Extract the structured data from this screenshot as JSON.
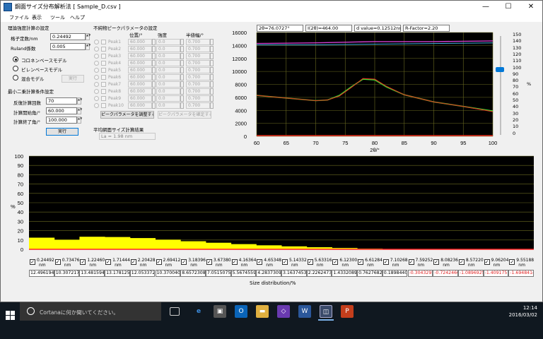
{
  "window": {
    "title": "鋼面サイズ分布解析法 [ Sample_D.csv ]",
    "minimize": "—",
    "maximize": "☐",
    "close": "✕"
  },
  "menu": [
    "ファイル",
    "表示",
    "ツール",
    "ヘルプ"
  ],
  "theory": {
    "section_title": "理論強度計算の設定",
    "lattice_label": "格子定数/nm",
    "lattice_value": "0.24492",
    "ruland_label": "Ruland係数",
    "ruland_value": "0.005",
    "models": [
      {
        "label": "コロネンベースモデル",
        "selected": true
      },
      {
        "label": "ピレンベースモデル",
        "selected": false
      },
      {
        "label": "混合モデル",
        "selected": false
      }
    ],
    "run_disabled": "実行"
  },
  "lsq": {
    "section_title": "最小二乗計算条件設定",
    "iter_label": "反復計算回数",
    "iter_value": "70",
    "start_label": "計算開始角/°",
    "start_value": "60.000",
    "end_label": "計算終了角/°",
    "end_value": "100.000",
    "run_button": "実行"
  },
  "impurity": {
    "section_title": "不純物ピークパラメータの設定",
    "col_pos": "位置/°",
    "col_int": "強度",
    "col_fwhm": "半値幅/°",
    "peaks": [
      {
        "name": "Peak1",
        "pos": "60.000",
        "int": "0.0",
        "fwhm": "0.700"
      },
      {
        "name": "Peak2",
        "pos": "60.000",
        "int": "0.0",
        "fwhm": "0.700"
      },
      {
        "name": "Peak3",
        "pos": "60.000",
        "int": "0.0",
        "fwhm": "0.700"
      },
      {
        "name": "Peak4",
        "pos": "60.000",
        "int": "0.0",
        "fwhm": "0.700"
      },
      {
        "name": "Peak5",
        "pos": "60.000",
        "int": "0.0",
        "fwhm": "0.700"
      },
      {
        "name": "Peak6",
        "pos": "60.000",
        "int": "0.0",
        "fwhm": "0.700"
      },
      {
        "name": "Peak7",
        "pos": "60.000",
        "int": "0.0",
        "fwhm": "0.700"
      },
      {
        "name": "Peak8",
        "pos": "60.000",
        "int": "0.0",
        "fwhm": "0.700"
      },
      {
        "name": "Peak9",
        "pos": "60.000",
        "int": "0.0",
        "fwhm": "0.700"
      },
      {
        "name": "Peak10",
        "pos": "60.000",
        "int": "0.0",
        "fwhm": "0.700"
      }
    ],
    "adjust_button": "ピークパラメータを調整する",
    "confirm_button": "ピークパラメータを確定する"
  },
  "result": {
    "section_title": "平均網面サイズ計算結果",
    "value": "La = 1.98 nm"
  },
  "readout": {
    "two_theta": "2θ=76.0727°",
    "intensity": "I(2θ)=464.00",
    "d_value": "d value=0.12512nm",
    "r_factor": "R-Factor=2.20"
  },
  "slider": {
    "ticks": [
      "150",
      "140",
      "130",
      "120",
      "110",
      "100",
      "90",
      "80",
      "70",
      "60",
      "50",
      "40",
      "30",
      "20",
      "10",
      "0"
    ],
    "unit": "%",
    "value": 100
  },
  "colors": {
    "observed": "#30e030",
    "calculated": "#e03020",
    "upper": "#d040d0",
    "bar_fill": "#ffff00",
    "negative": "#e02020"
  },
  "chart_data": [
    {
      "type": "line",
      "xlabel": "2θ/°",
      "ylabel": "",
      "xlim": [
        60,
        100
      ],
      "ylim": [
        0,
        16000
      ],
      "x_ticks": [
        "60",
        "65",
        "70",
        "75",
        "80",
        "85",
        "90",
        "95",
        "100"
      ],
      "y_ticks": [
        "16000",
        "14000",
        "12000",
        "10000",
        "8000",
        "6000",
        "4000",
        "2000",
        "0"
      ],
      "grid": true,
      "series": [
        {
          "x": [
            60,
            65,
            70,
            72,
            74,
            76,
            78,
            80,
            82,
            85,
            90,
            95,
            100
          ],
          "y": [
            6300,
            5900,
            5500,
            5600,
            6300,
            7600,
            8800,
            8700,
            7600,
            6400,
            5300,
            4600,
            3900
          ]
        },
        {
          "x": [
            60,
            65,
            70,
            72,
            74,
            76,
            78,
            80,
            82,
            85,
            90,
            95,
            100
          ],
          "y": [
            6300,
            5900,
            5500,
            5600,
            6200,
            7500,
            8900,
            8800,
            7700,
            6400,
            5300,
            4600,
            3800
          ]
        },
        {
          "x": [
            60,
            70,
            80,
            90,
            100
          ],
          "y": [
            14300,
            14400,
            14600,
            14600,
            14700
          ]
        },
        {
          "x": [
            60,
            70,
            80,
            90,
            100
          ],
          "y": [
            14100,
            14100,
            14200,
            14300,
            14400
          ]
        },
        {
          "x": [
            60,
            100
          ],
          "y": [
            100,
            100
          ]
        }
      ]
    },
    {
      "type": "bar",
      "xlabel": "Size distribution/%",
      "ylabel": "%",
      "ylim": [
        0,
        100
      ],
      "y_ticks": [
        "100",
        "90",
        "80",
        "70",
        "60",
        "50",
        "40",
        "30",
        "20",
        "10",
        "0"
      ],
      "grid": true,
      "categories": [
        "0.24492",
        "0.73476",
        "1.22460",
        "1.71444",
        "2.20428",
        "2.69412",
        "3.18396",
        "3.67380",
        "4.16364",
        "4.65348",
        "5.14332",
        "5.63316",
        "6.12300",
        "6.61284",
        "7.10268",
        "7.59252",
        "8.08236",
        "8.57220",
        "9.06204",
        "9.55188"
      ],
      "unit_label": "nm",
      "values_text": [
        "12.4961945",
        "10.3072171",
        "13.4815945",
        "13.1781251",
        "12.0533723",
        "10.3700401",
        "8.65723089",
        "7.05150752",
        "5.56745591",
        "4.28373091",
        "3.16374532",
        "2.22624731",
        "1.43320891",
        "0.76276821",
        "0.18984401",
        "-0.3043295",
        "-0.7242460",
        "-1.0896925",
        "-1.4091751",
        "-1.6948414"
      ],
      "values": [
        12.4962,
        10.3072,
        13.4816,
        13.1781,
        12.0534,
        10.37,
        8.6572,
        7.0515,
        5.5675,
        4.2837,
        3.1637,
        2.2262,
        1.4332,
        0.7628,
        0.1898,
        -0.3043,
        -0.7242,
        -1.0897,
        -1.4092,
        -1.6948
      ]
    }
  ],
  "taskbar": {
    "search_placeholder": "Cortanaに何か聞いてください。",
    "time": "12:14",
    "date": "2016/03/02"
  }
}
